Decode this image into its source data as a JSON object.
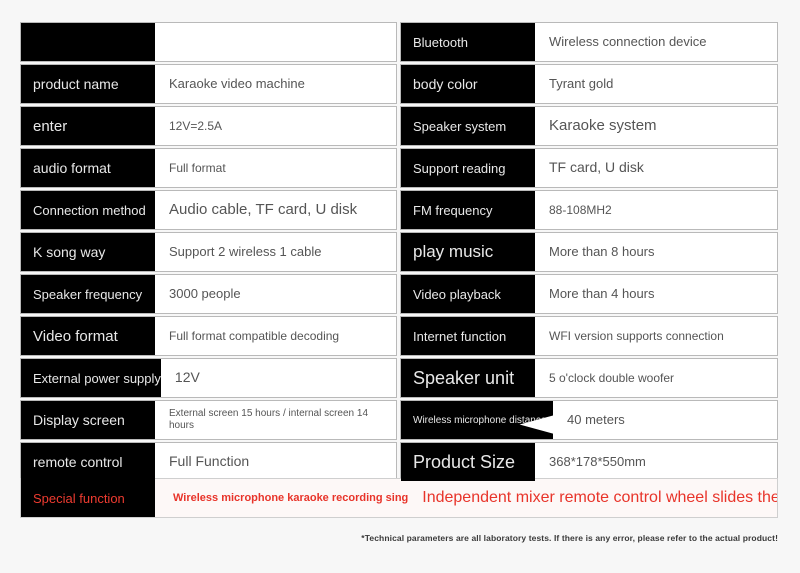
{
  "page": {
    "background_color": "#f7f7f7",
    "label_cell_color": "#000000",
    "label_text_color": "#e8e8e8",
    "value_text_color": "#555555",
    "accent_red": "#e8342a"
  },
  "left_table": {
    "rows": [
      {
        "label": "",
        "value": ""
      },
      {
        "label": "product name",
        "value": "Karaoke video machine"
      },
      {
        "label": "enter",
        "value": "12V=2.5A"
      },
      {
        "label": "audio format",
        "value": "Full format"
      },
      {
        "label": "Connection method",
        "value": "Audio cable, TF card, U disk"
      },
      {
        "label": "K song way",
        "value": "Support 2 wireless 1 cable"
      },
      {
        "label": "Speaker frequency",
        "value": "3000 people"
      },
      {
        "label": "Video format",
        "value": "Full format compatible decoding"
      },
      {
        "label": "External power supply",
        "value": "12V"
      },
      {
        "label": "Display screen",
        "value": "External screen 15 hours / internal screen 14 hours"
      },
      {
        "label": "remote control",
        "value": "Full Function"
      }
    ]
  },
  "right_table": {
    "rows": [
      {
        "label": "Bluetooth",
        "value": "Wireless connection device"
      },
      {
        "label": "body color",
        "value": "Tyrant gold"
      },
      {
        "label": "Speaker system",
        "value": "Karaoke system"
      },
      {
        "label": "Support reading",
        "value": "TF card, U disk"
      },
      {
        "label": "FM frequency",
        "value": "88-108MH2"
      },
      {
        "label": "play music",
        "value": "More than 8 hours"
      },
      {
        "label": "Video playback",
        "value": "More than 4 hours"
      },
      {
        "label": "Internet function",
        "value": "WFI version supports connection"
      },
      {
        "label": "Speaker unit",
        "value": "5 o'clock double woofer"
      },
      {
        "label": "Wireless microphone distance",
        "value": "40 meters"
      },
      {
        "label": "Product Size",
        "value": "368*178*550mm"
      }
    ]
  },
  "special_function": {
    "label": "Special function",
    "value_primary": "Wireless microphone karaoke recording sing",
    "value_secondary": "Independent mixer remote control wheel slides the lifting lever."
  },
  "footer": {
    "note": "*Technical parameters are all laboratory tests. If there is any error, please refer to the actual product!"
  }
}
